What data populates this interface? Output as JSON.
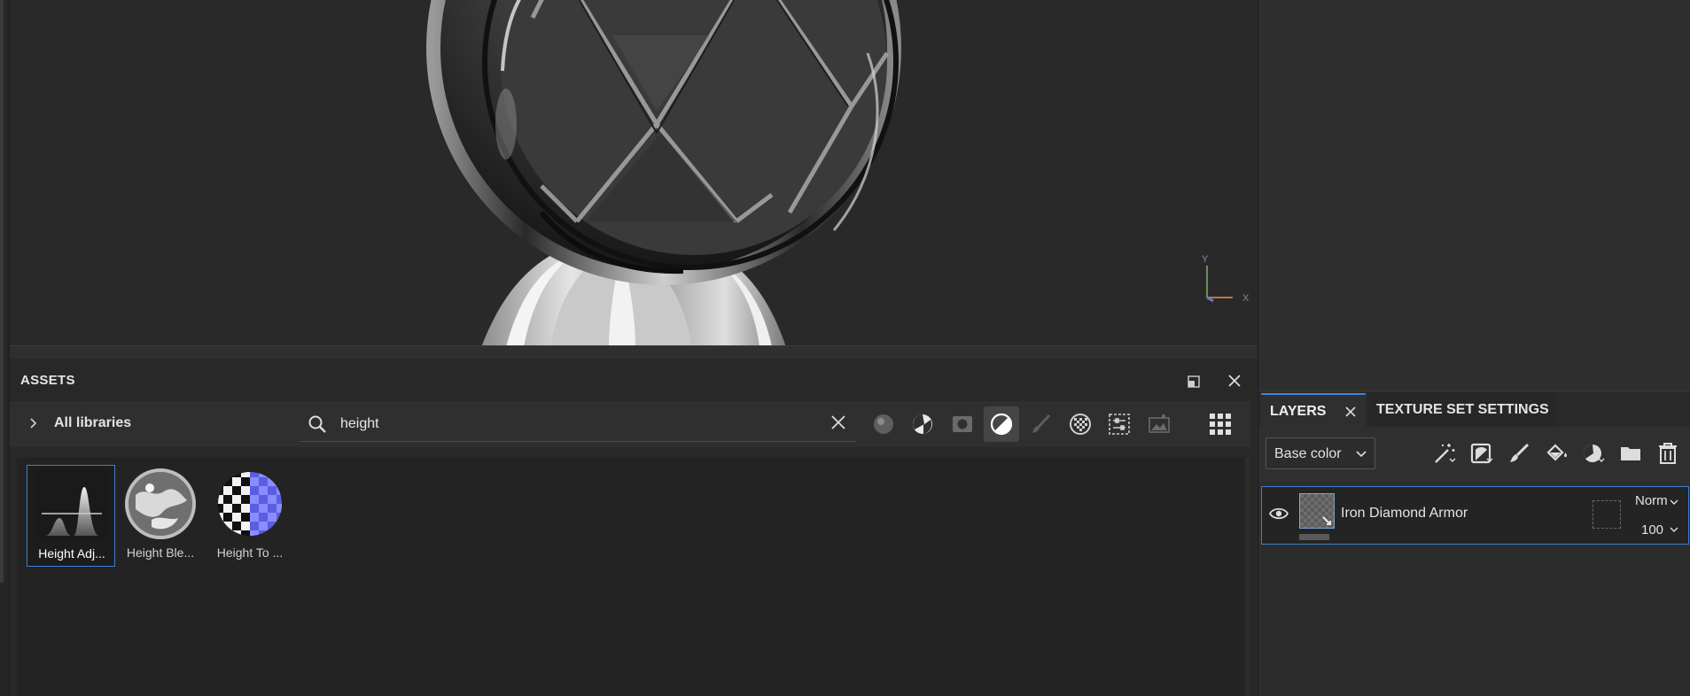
{
  "viewport": {
    "axis": {
      "y_label": "Y",
      "x_label": "X"
    }
  },
  "assets": {
    "title": "ASSETS",
    "library_label": "All libraries",
    "search": {
      "value": "height",
      "placeholder": ""
    },
    "filters": [
      "materials-filter-icon",
      "smart-materials-filter-icon",
      "smart-masks-filter-icon",
      "filters-filter-icon",
      "brushes-filter-icon",
      "textures-filter-icon",
      "generators-filter-icon",
      "environments-filter-icon"
    ],
    "active_filter": "filters-filter-icon",
    "items": [
      {
        "label": "Height Adj...",
        "icon": "height-adjust-thumbnail",
        "selected": true
      },
      {
        "label": "Height Ble...",
        "icon": "height-blend-thumbnail",
        "selected": false
      },
      {
        "label": "Height To ...",
        "icon": "height-to-normal-thumbnail",
        "selected": false
      }
    ]
  },
  "layers_panel": {
    "tabs": [
      {
        "label": "LAYERS",
        "active": true
      },
      {
        "label": "TEXTURE SET SETTINGS",
        "active": false
      }
    ],
    "channel": "Base color",
    "toolbar_icons": [
      "add-effect-icon",
      "add-mask-icon",
      "add-paint-layer-icon",
      "add-fill-layer-icon",
      "add-smart-material-icon",
      "add-folder-icon",
      "delete-layer-icon"
    ],
    "layers": [
      {
        "name": "Iron Diamond Armor",
        "blend_mode": "Norm",
        "opacity": "100",
        "visible": true
      }
    ]
  },
  "colors": {
    "accent": "#3d7fd1",
    "panel_bg": "#282828",
    "viewport_bg": "#292929"
  }
}
